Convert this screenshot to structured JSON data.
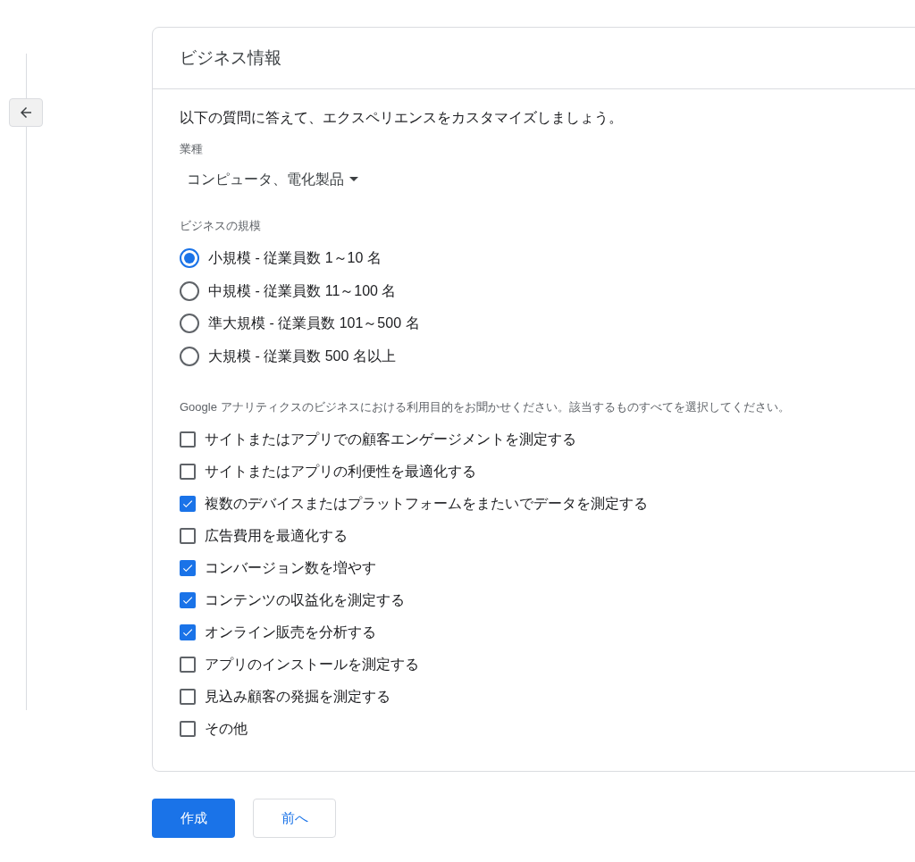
{
  "card": {
    "title": "ビジネス情報",
    "intro": "以下の質問に答えて、エクスペリエンスをカスタマイズしましょう。",
    "industry": {
      "label": "業種",
      "value": "コンピュータ、電化製品"
    },
    "size": {
      "label": "ビジネスの規模",
      "options": [
        {
          "label": "小規模 - 従業員数 1～10 名",
          "selected": true
        },
        {
          "label": "中規模 - 従業員数 11～100 名",
          "selected": false
        },
        {
          "label": "準大規模 - 従業員数 101～500 名",
          "selected": false
        },
        {
          "label": "大規模 - 従業員数 500 名以上",
          "selected": false
        }
      ]
    },
    "purposes": {
      "label": "Google アナリティクスのビジネスにおける利用目的をお聞かせください。該当するものすべてを選択してください。",
      "options": [
        {
          "label": "サイトまたはアプリでの顧客エンゲージメントを測定する",
          "checked": false
        },
        {
          "label": "サイトまたはアプリの利便性を最適化する",
          "checked": false
        },
        {
          "label": "複数のデバイスまたはプラットフォームをまたいでデータを測定する",
          "checked": true
        },
        {
          "label": "広告費用を最適化する",
          "checked": false
        },
        {
          "label": "コンバージョン数を増やす",
          "checked": true
        },
        {
          "label": "コンテンツの収益化を測定する",
          "checked": true
        },
        {
          "label": "オンライン販売を分析する",
          "checked": true
        },
        {
          "label": "アプリのインストールを測定する",
          "checked": false
        },
        {
          "label": "見込み顧客の発掘を測定する",
          "checked": false
        },
        {
          "label": "その他",
          "checked": false
        }
      ]
    }
  },
  "buttons": [
    {
      "label": "作成",
      "kind": "primary"
    },
    {
      "label": "前へ",
      "kind": "secondary"
    }
  ]
}
